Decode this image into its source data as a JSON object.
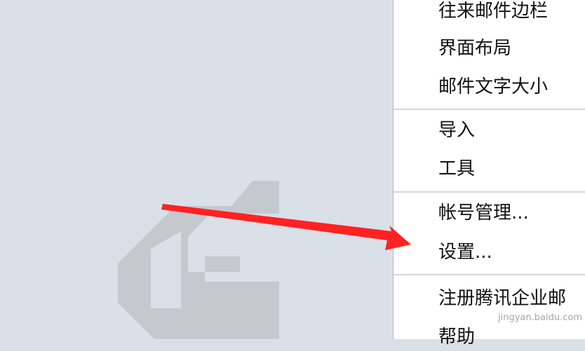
{
  "context_menu": {
    "items": [
      {
        "label": "往来邮件边栏"
      },
      {
        "label": "界面布局"
      },
      {
        "label": "邮件文字大小"
      },
      {
        "label": "导入"
      },
      {
        "label": "工具"
      },
      {
        "label": "帐号管理..."
      },
      {
        "label": "设置..."
      },
      {
        "label": "注册腾讯企业邮"
      },
      {
        "label": "帮助"
      }
    ]
  },
  "watermark": {
    "text": "jingyan.baidu.com"
  },
  "colors": {
    "background": "#d9e0e8",
    "menu_background": "#ffffff",
    "arrow": "#ff2222",
    "logo": "#c4c9d0"
  }
}
